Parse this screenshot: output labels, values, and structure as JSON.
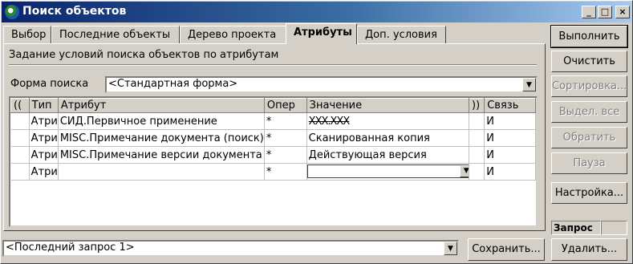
{
  "window": {
    "title": "Поиск объектов",
    "controls": [
      "_",
      "□",
      "×"
    ]
  },
  "tabs": [
    {
      "label": "Выбор"
    },
    {
      "label": "Последние объекты"
    },
    {
      "label": "Дерево проекта"
    },
    {
      "label": "Атрибуты",
      "active": true
    },
    {
      "label": "Доп. условия"
    }
  ],
  "panel": {
    "heading": "Задание условий поиска объектов по атрибутам",
    "form_label": "Форма поиска",
    "form_value": "<Стандартная форма>"
  },
  "grid": {
    "columns": [
      "((",
      "Тип",
      "Атрибут",
      "Опер",
      "Значение",
      "))",
      "Связь"
    ],
    "rows": [
      [
        "",
        "Атри",
        "СИД.Первичное применение",
        "*",
        "ХХХ.ХХХ",
        "",
        "И"
      ],
      [
        "",
        "Атри",
        "MISC.Примечание документа (поиск)",
        "*",
        "Сканированная копия",
        "",
        "И"
      ],
      [
        "",
        "Атри",
        "MISC.Примечание версии документа",
        "*",
        "Действующая версия",
        "",
        "И"
      ],
      [
        "",
        "Атри",
        "",
        "*",
        "",
        "",
        "И"
      ]
    ]
  },
  "actions": {
    "execute": "Выполнить",
    "clear": "Очистить",
    "sort": "Сортировка...",
    "select_all": "Выдел. все",
    "invert": "Обратить",
    "pause": "Пауза",
    "settings": "Настройка...",
    "status_label": "Запрос",
    "status_value": "",
    "delete": "Удалить..."
  },
  "bottom": {
    "query_value": "<Последний запрос 1>",
    "save": "Сохранить..."
  }
}
